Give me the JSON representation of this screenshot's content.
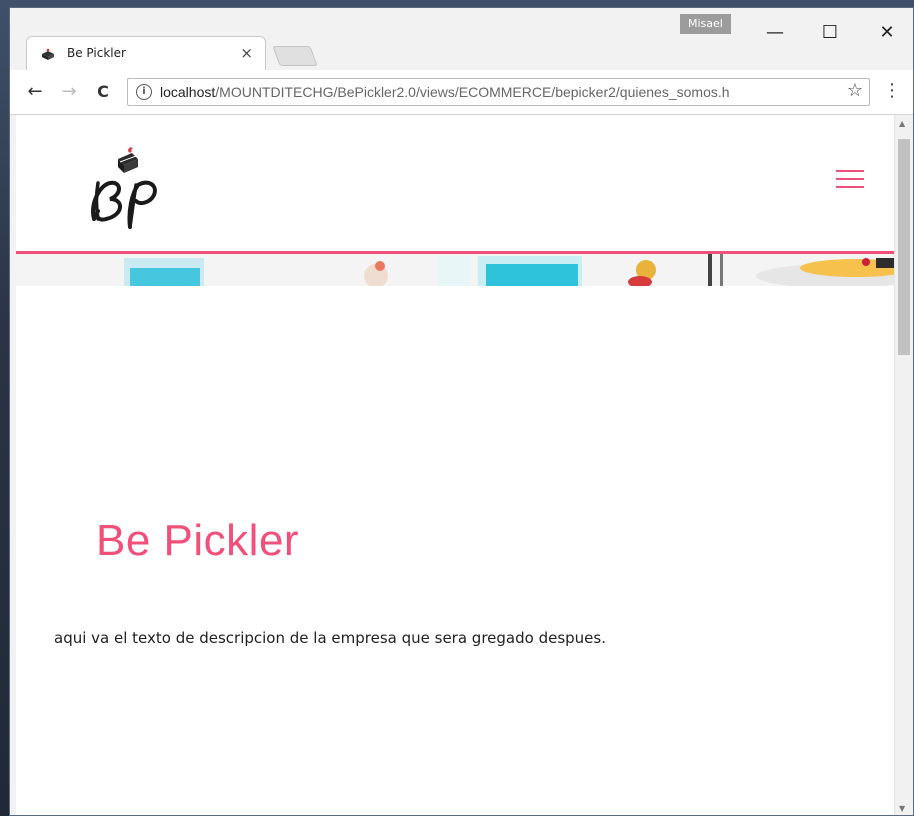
{
  "browser": {
    "profile_name": "Misael",
    "window_controls": {
      "minimize": "—",
      "maximize": "☐",
      "close": "✕"
    },
    "tab": {
      "title": "Be Pickler",
      "close": "×",
      "favicon": "cake-icon"
    },
    "toolbar": {
      "back": "←",
      "forward": "→",
      "reload": "C",
      "info": "i",
      "url_host": "localhost",
      "url_path": "/MOUNTDITECHG/BePickler2.0/views/ECOMMERCE/bepicker2/quienes_somos.h",
      "bookmark": "☆",
      "menu": "⋮"
    }
  },
  "page": {
    "logo_alt": "BP",
    "title": "Be Pickler",
    "description": "aqui va el texto de descripcion de la empresa que sera gregado despues.",
    "accent_color": "#f2507b"
  },
  "scrollbar": {
    "up": "▲",
    "down": "▼"
  }
}
